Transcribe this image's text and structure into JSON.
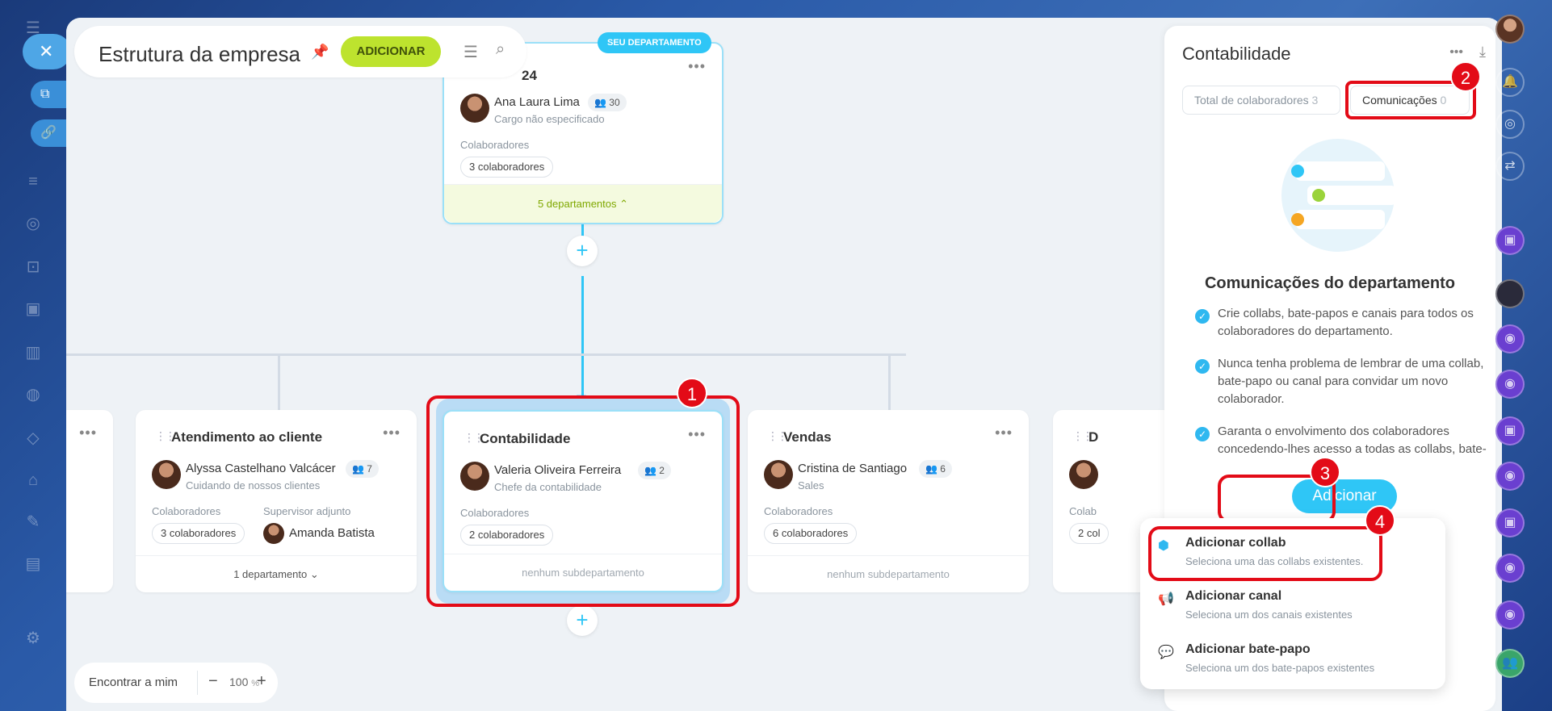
{
  "header": {
    "title": "Estrutura da empresa",
    "add_label": "ADICIONAR"
  },
  "top_card": {
    "badge": "SEU DEPARTAMENTO",
    "title_fragment": "24",
    "head_name": "Ana Laura Lima",
    "head_count": "30",
    "head_role": "Cargo não especificado",
    "collab_label": "Colaboradores",
    "collab_chip": "3 colaboradores",
    "footer": "5 departamentos"
  },
  "cards": {
    "atendimento": {
      "title": "Atendimento ao cliente",
      "head_name": "Alyssa Castelhano Valcácer",
      "head_count": "7",
      "head_role": "Cuidando de nossos clientes",
      "collab_label": "Colaboradores",
      "collab_chip": "3 colaboradores",
      "deputy_label": "Supervisor adjunto",
      "deputy_name": "Amanda Batista",
      "footer": "1 departamento"
    },
    "contabilidade": {
      "title": "Contabilidade",
      "head_name": "Valeria Oliveira Ferreira",
      "head_count": "2",
      "head_role": "Chefe da contabilidade",
      "collab_label": "Colaboradores",
      "collab_chip": "2 colaboradores",
      "footer": "nenhum subdepartamento"
    },
    "vendas": {
      "title": "Vendas",
      "head_name": "Cristina de Santiago",
      "head_count": "6",
      "head_role": "Sales",
      "collab_label": "Colaboradores",
      "collab_chip": "6 colaboradores",
      "footer": "nenhum subdepartamento"
    },
    "partial": {
      "title": "D",
      "collab_label": "Colab",
      "collab_chip": "2 col"
    }
  },
  "zoom": {
    "find_me": "Encontrar a mim",
    "value": "100",
    "unit": "%"
  },
  "panel": {
    "title": "Contabilidade",
    "tab_total_label": "Total de colaboradores",
    "tab_total_count": "3",
    "tab_comm_label": "Comunicações",
    "tab_comm_count": "0",
    "section_title": "Comunicações do departamento",
    "bullets": [
      "Crie collabs, bate-papos e canais para todos os colaboradores do departamento.",
      "Nunca tenha problema de lembrar de uma collab, bate-papo ou canal para convidar um novo colaborador.",
      "Garanta o envolvimento dos colaboradores concedendo-lhes acesso a todas as collabs, bate-papos e canais que preci"
    ],
    "add_button": "Adicionar"
  },
  "menu": {
    "items": [
      {
        "title": "Adicionar collab",
        "sub": "Seleciona uma das collabs existentes."
      },
      {
        "title": "Adicionar canal",
        "sub": "Seleciona um dos canais existentes"
      },
      {
        "title": "Adicionar bate-papo",
        "sub": "Seleciona um dos bate-papos existentes"
      }
    ]
  },
  "annotations": [
    "1",
    "2",
    "3",
    "4"
  ],
  "colors": {
    "accent_blue": "#2fc6f6",
    "add_green": "#bde32e",
    "annotation_red": "#e30b17"
  }
}
